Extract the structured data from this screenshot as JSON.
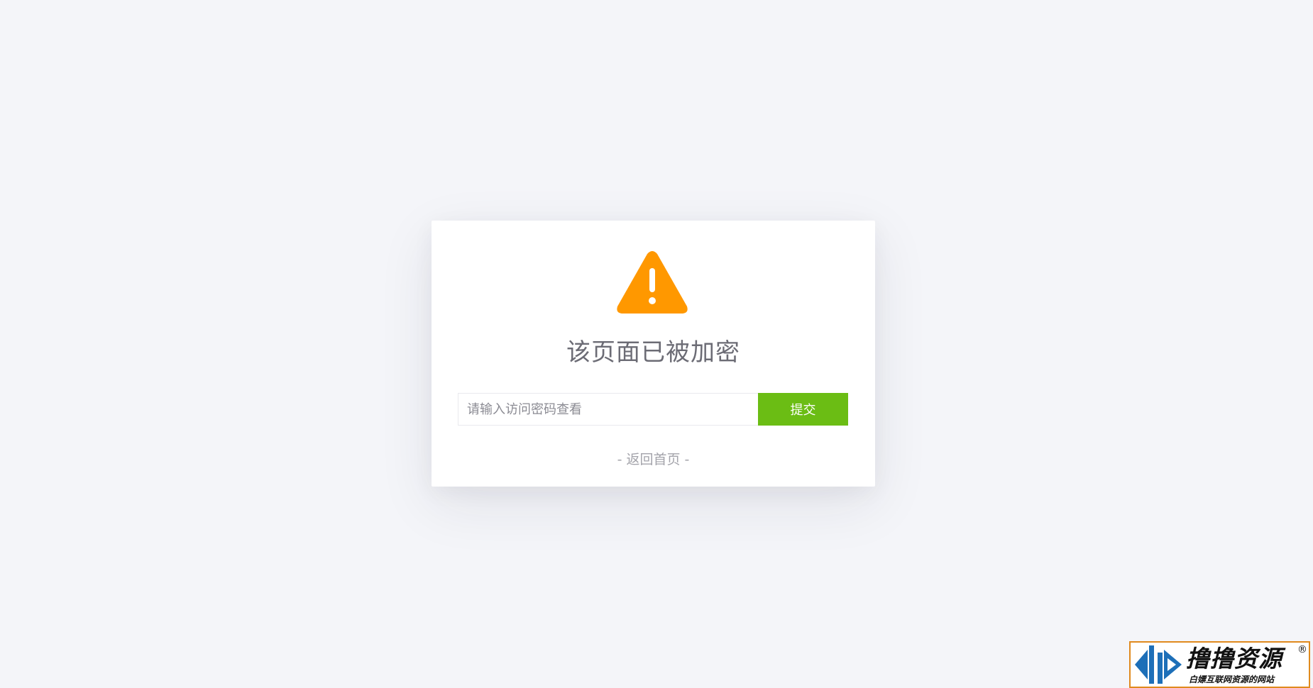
{
  "lock_card": {
    "title": "该页面已被加密",
    "password_placeholder": "请输入访问密码查看",
    "password_value": "",
    "submit_label": "提交",
    "back_link_label": "- 返回首页 -",
    "warning_icon": "warning-triangle-icon",
    "colors": {
      "warning": "#ff9800",
      "submit": "#6bbd14",
      "background": "#f4f5f9"
    }
  },
  "watermark": {
    "main_text": "撸撸资源",
    "sub_text": "白嫖互联网资源的网站",
    "registered_mark": "®",
    "logo_icon": "lulu-logo-icon",
    "colors": {
      "border": "#e08a1e",
      "logo": "#1d6fb8"
    }
  }
}
